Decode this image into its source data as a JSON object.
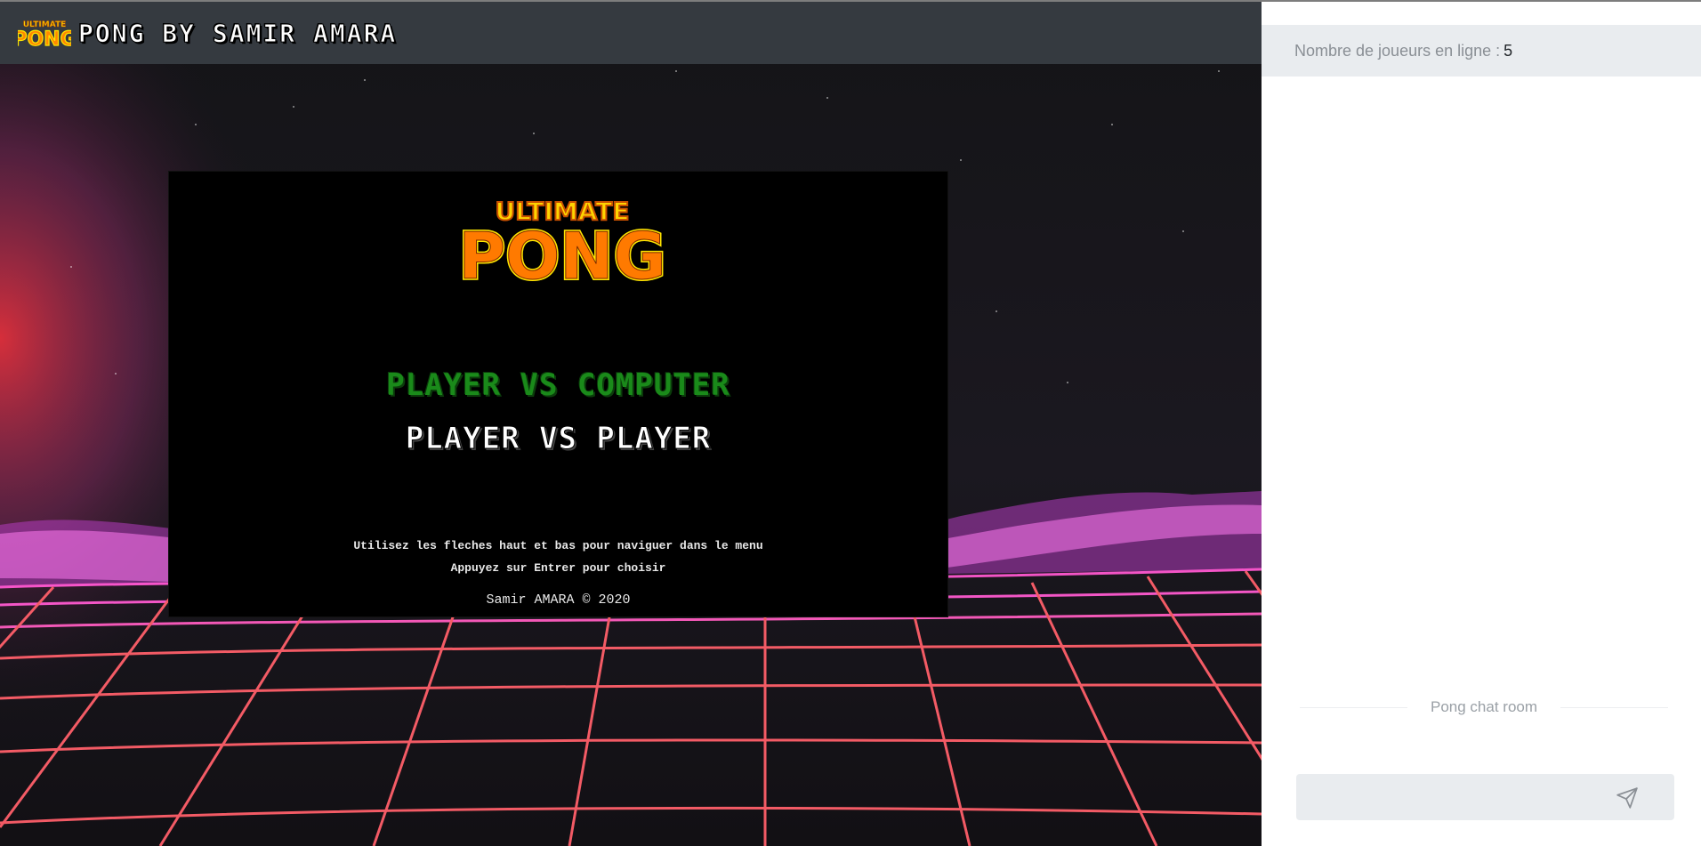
{
  "header": {
    "logo": {
      "line1": "ULTIMATE",
      "line2": "PONG"
    },
    "title": "PONG BY SAMIR AMARA"
  },
  "game": {
    "logo": {
      "line1": "ULTIMATE",
      "line2": "PONG"
    },
    "menu": [
      {
        "label": "PLAYER VS COMPUTER",
        "selected": true,
        "color": "#1a8a1a"
      },
      {
        "label": "PLAYER VS PLAYER",
        "selected": false,
        "color": "#ffffff"
      }
    ],
    "instructions": [
      "Utilisez les fleches haut et bas pour naviguer dans le menu",
      "Appuyez sur Entrer pour choisir"
    ],
    "copyright": "Samir AMARA © 2020"
  },
  "chat": {
    "online_label": "Nombre de joueurs en ligne :",
    "online_count": "5",
    "room_label": "Pong chat room",
    "input_placeholder": "",
    "send_icon": "send-icon"
  },
  "colors": {
    "topbar": "#353a40",
    "panel_bar": "#e9ecef",
    "grid_pink": "#ff4fd8",
    "grid_orange": "#ff6a4a",
    "logo_yellow": "#ffd400",
    "logo_orange": "#ff6a00"
  }
}
